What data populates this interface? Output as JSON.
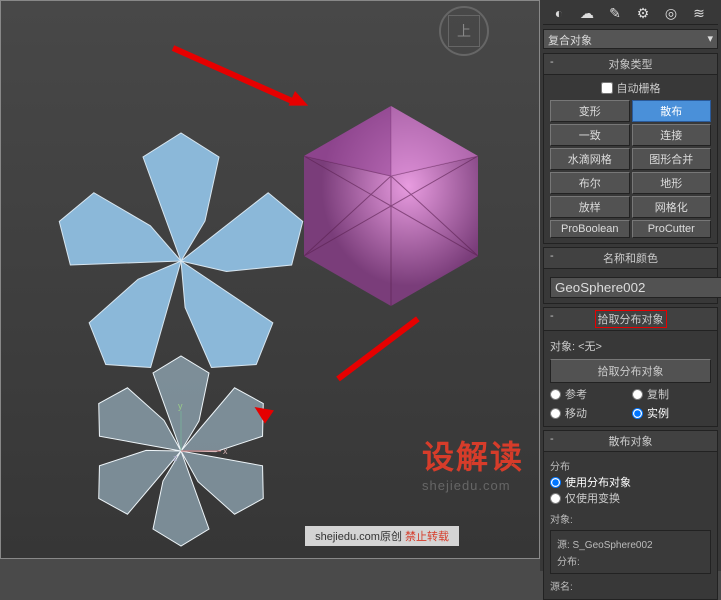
{
  "viewport": {
    "nav_face": "上",
    "watermark_text": "设解读",
    "watermark_sub": "shejiedu.com",
    "watermark_bar_left": "shejiedu.com原创 ",
    "watermark_bar_right": "禁止转载"
  },
  "dropdown_value": "复合对象",
  "rollout_object_type": {
    "title": "对象类型",
    "auto_grid": "自动栅格",
    "buttons": [
      [
        "变形",
        "散布"
      ],
      [
        "一致",
        "连接"
      ],
      [
        "水滴网格",
        "图形合并"
      ],
      [
        "布尔",
        "地形"
      ],
      [
        "放样",
        "网格化"
      ],
      [
        "ProBoolean",
        "ProCutter"
      ]
    ],
    "active_index": [
      0,
      1
    ]
  },
  "rollout_name_color": {
    "title": "名称和颜色",
    "name_value": "GeoSphere002",
    "color": "#4a76c9"
  },
  "rollout_pick": {
    "title": "拾取分布对象",
    "object_label": "对象:",
    "object_value": "<无>",
    "pick_button": "拾取分布对象",
    "radios": [
      {
        "label": "参考",
        "checked": false
      },
      {
        "label": "复制",
        "checked": false
      },
      {
        "label": "移动",
        "checked": false
      },
      {
        "label": "实例",
        "checked": true
      }
    ]
  },
  "rollout_scatter": {
    "title": "散布对象",
    "group_label": "分布",
    "radio1": "使用分布对象",
    "radio2": "仅使用变换",
    "objects_label": "对象:",
    "source_line1": "源: S_GeoSphere002",
    "source_line2": "分布:",
    "footer": "源名:"
  }
}
